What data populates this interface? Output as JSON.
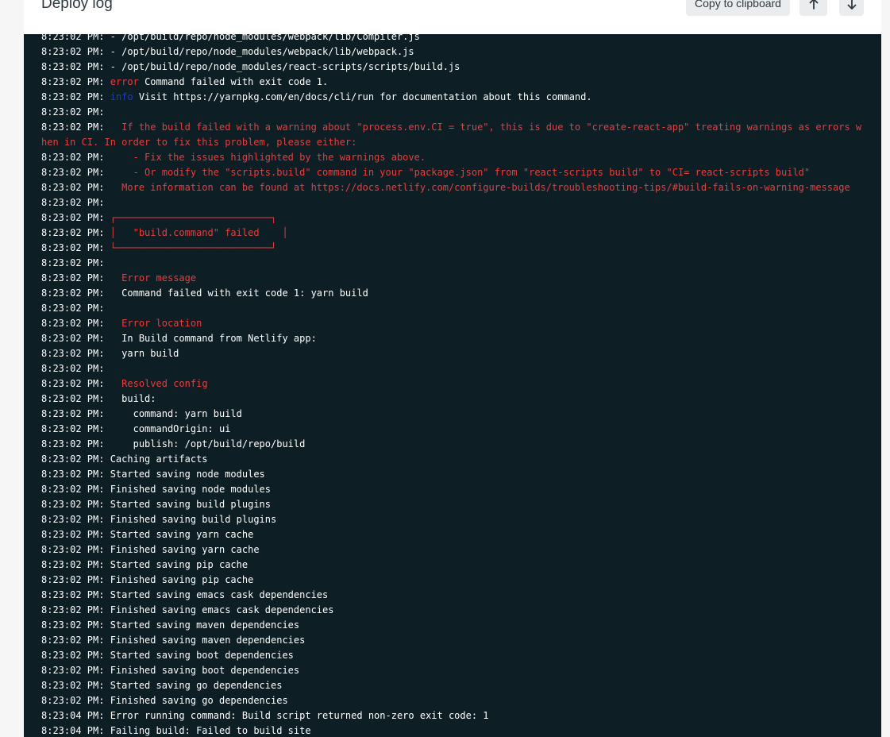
{
  "header": {
    "title": "Deploy log",
    "copy_label": "Copy to clipboard",
    "scroll_top_icon": "arrow-up-icon",
    "scroll_bottom_icon": "arrow-down-icon"
  },
  "colors": {
    "log_background": "#0e1e25",
    "error_red": "#e83e3e",
    "info_blue": "#1d39d1"
  },
  "log_lines": [
    {
      "ts": "8:23:02 PM:",
      "segments": [
        {
          "t": " - /opt/build/repo/node_modules/webpack/lib/Compiler.js"
        }
      ]
    },
    {
      "ts": "8:23:02 PM:",
      "segments": [
        {
          "t": " - /opt/build/repo/node_modules/webpack/lib/webpack.js"
        }
      ]
    },
    {
      "ts": "8:23:02 PM:",
      "segments": [
        {
          "t": " - /opt/build/repo/node_modules/react-scripts/scripts/build.js"
        }
      ]
    },
    {
      "ts": "8:23:02 PM:",
      "segments": [
        {
          "t": " "
        },
        {
          "t": "error",
          "c": "red"
        },
        {
          "t": " Command failed with exit code 1."
        }
      ]
    },
    {
      "ts": "8:23:02 PM:",
      "segments": [
        {
          "t": " "
        },
        {
          "t": "info",
          "c": "blue"
        },
        {
          "t": " Visit https://yarnpkg.com/en/docs/cli/run for documentation about this command."
        }
      ]
    },
    {
      "ts": "8:23:02 PM:",
      "segments": []
    },
    {
      "ts": "8:23:02 PM:",
      "segments": [
        {
          "t": "   If the build failed with a warning about \"process.env.CI = true\", this is due to \"create-react-app\" treating warnings as errors when in CI. In order to fix this problem, please either:",
          "c": "red"
        }
      ]
    },
    {
      "ts": "8:23:02 PM:",
      "segments": [
        {
          "t": "     - Fix the issues highlighted by the warnings above.",
          "c": "red"
        }
      ]
    },
    {
      "ts": "8:23:02 PM:",
      "segments": [
        {
          "t": "     - Or modify the \"scripts.build\" command in your \"package.json\" from \"react-scripts build\" to \"CI= react-scripts build\"",
          "c": "red"
        }
      ]
    },
    {
      "ts": "8:23:02 PM:",
      "segments": [
        {
          "t": "   More information can be found at https://docs.netlify.com/configure-builds/troubleshooting-tips/#build-fails-on-warning-message",
          "c": "red"
        }
      ]
    },
    {
      "ts": "8:23:02 PM:",
      "segments": []
    },
    {
      "ts": "8:23:02 PM:",
      "segments": [
        {
          "t": " ┌───────────────────────────┐",
          "c": "red"
        }
      ]
    },
    {
      "ts": "8:23:02 PM:",
      "segments": [
        {
          "t": " │   \"build.command\" failed    │",
          "c": "red"
        }
      ]
    },
    {
      "ts": "8:23:02 PM:",
      "segments": [
        {
          "t": " └───────────────────────────┘",
          "c": "red"
        }
      ]
    },
    {
      "ts": "8:23:02 PM:",
      "segments": []
    },
    {
      "ts": "8:23:02 PM:",
      "segments": [
        {
          "t": "   "
        },
        {
          "t": "Error message",
          "c": "red"
        }
      ]
    },
    {
      "ts": "8:23:02 PM:",
      "segments": [
        {
          "t": "   Command failed with exit code 1: yarn build"
        }
      ]
    },
    {
      "ts": "8:23:02 PM:",
      "segments": []
    },
    {
      "ts": "8:23:02 PM:",
      "segments": [
        {
          "t": "   "
        },
        {
          "t": "Error location",
          "c": "red"
        }
      ]
    },
    {
      "ts": "8:23:02 PM:",
      "segments": [
        {
          "t": "   In Build command from Netlify app:"
        }
      ]
    },
    {
      "ts": "8:23:02 PM:",
      "segments": [
        {
          "t": "   yarn build"
        }
      ]
    },
    {
      "ts": "8:23:02 PM:",
      "segments": []
    },
    {
      "ts": "8:23:02 PM:",
      "segments": [
        {
          "t": "   "
        },
        {
          "t": "Resolved config",
          "c": "red"
        }
      ]
    },
    {
      "ts": "8:23:02 PM:",
      "segments": [
        {
          "t": "   build:"
        }
      ]
    },
    {
      "ts": "8:23:02 PM:",
      "segments": [
        {
          "t": "     command: yarn build"
        }
      ]
    },
    {
      "ts": "8:23:02 PM:",
      "segments": [
        {
          "t": "     commandOrigin: ui"
        }
      ]
    },
    {
      "ts": "8:23:02 PM:",
      "segments": [
        {
          "t": "     publish: /opt/build/repo/build"
        }
      ]
    },
    {
      "ts": "8:23:02 PM:",
      "segments": [
        {
          "t": " Caching artifacts"
        }
      ]
    },
    {
      "ts": "8:23:02 PM:",
      "segments": [
        {
          "t": " Started saving node modules"
        }
      ]
    },
    {
      "ts": "8:23:02 PM:",
      "segments": [
        {
          "t": " Finished saving node modules"
        }
      ]
    },
    {
      "ts": "8:23:02 PM:",
      "segments": [
        {
          "t": " Started saving build plugins"
        }
      ]
    },
    {
      "ts": "8:23:02 PM:",
      "segments": [
        {
          "t": " Finished saving build plugins"
        }
      ]
    },
    {
      "ts": "8:23:02 PM:",
      "segments": [
        {
          "t": " Started saving yarn cache"
        }
      ]
    },
    {
      "ts": "8:23:02 PM:",
      "segments": [
        {
          "t": " Finished saving yarn cache"
        }
      ]
    },
    {
      "ts": "8:23:02 PM:",
      "segments": [
        {
          "t": " Started saving pip cache"
        }
      ]
    },
    {
      "ts": "8:23:02 PM:",
      "segments": [
        {
          "t": " Finished saving pip cache"
        }
      ]
    },
    {
      "ts": "8:23:02 PM:",
      "segments": [
        {
          "t": " Started saving emacs cask dependencies"
        }
      ]
    },
    {
      "ts": "8:23:02 PM:",
      "segments": [
        {
          "t": " Finished saving emacs cask dependencies"
        }
      ]
    },
    {
      "ts": "8:23:02 PM:",
      "segments": [
        {
          "t": " Started saving maven dependencies"
        }
      ]
    },
    {
      "ts": "8:23:02 PM:",
      "segments": [
        {
          "t": " Finished saving maven dependencies"
        }
      ]
    },
    {
      "ts": "8:23:02 PM:",
      "segments": [
        {
          "t": " Started saving boot dependencies"
        }
      ]
    },
    {
      "ts": "8:23:02 PM:",
      "segments": [
        {
          "t": " Finished saving boot dependencies"
        }
      ]
    },
    {
      "ts": "8:23:02 PM:",
      "segments": [
        {
          "t": " Started saving go dependencies"
        }
      ]
    },
    {
      "ts": "8:23:02 PM:",
      "segments": [
        {
          "t": " Finished saving go dependencies"
        }
      ]
    },
    {
      "ts": "8:23:04 PM:",
      "segments": [
        {
          "t": " Error running command: Build script returned non-zero exit code: 1"
        }
      ]
    },
    {
      "ts": "8:23:04 PM:",
      "segments": [
        {
          "t": " Failing build: Failed to build site"
        }
      ]
    }
  ]
}
